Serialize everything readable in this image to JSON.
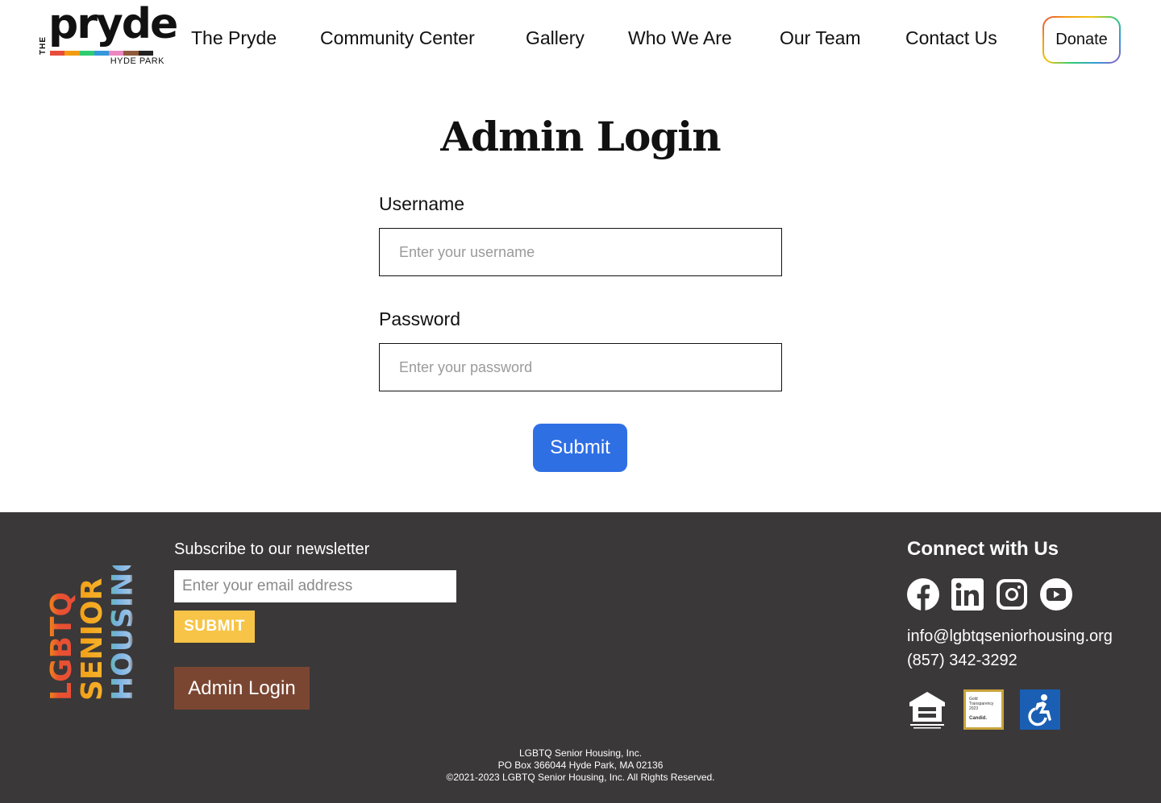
{
  "header": {
    "logo": {
      "prefix": "THE",
      "word": "pryde",
      "sub": "HYDE PARK",
      "stripe_colors": [
        "#e74c3c",
        "#f39c12",
        "#2ecc71",
        "#3498db",
        "#ec87c0",
        "#8e5a3c",
        "#222222"
      ]
    },
    "nav": [
      {
        "label": "The Pryde"
      },
      {
        "label": "Community Center"
      },
      {
        "label": "Gallery"
      },
      {
        "label": "Who We Are"
      },
      {
        "label": "Our Team"
      },
      {
        "label": "Contact Us"
      }
    ],
    "donate_label": "Donate"
  },
  "main": {
    "title": "Admin Login",
    "username": {
      "label": "Username",
      "placeholder": "Enter your username"
    },
    "password": {
      "label": "Password",
      "placeholder": "Enter your password"
    },
    "submit_label": "Submit",
    "accent_color": "#2f6fe4"
  },
  "footer": {
    "logo": {
      "words": [
        "LGBTQ",
        "SENIOR",
        "HOUSING"
      ]
    },
    "newsletter": {
      "title": "Subscribe to our newsletter",
      "placeholder": "Enter your email address",
      "submit_label": "SUBMIT"
    },
    "admin_label": "Admin Login",
    "connect_title": "Connect with Us",
    "socials": [
      "facebook-icon",
      "linkedin-icon",
      "instagram-icon",
      "youtube-icon"
    ],
    "email": "info@lgbtqseniorhousing.org",
    "phone": "(857) 342-3292",
    "candid": {
      "line1": "Gold",
      "line2": "Transparency",
      "line3": "2023",
      "brand": "Candid."
    },
    "legal": [
      "LGBTQ Senior Housing, Inc.",
      "PO Box 366044 Hyde Park, MA 02136",
      "©2021-2023 LGBTQ Senior Housing, Inc. All Rights Reserved."
    ],
    "background": "#3a3839"
  }
}
